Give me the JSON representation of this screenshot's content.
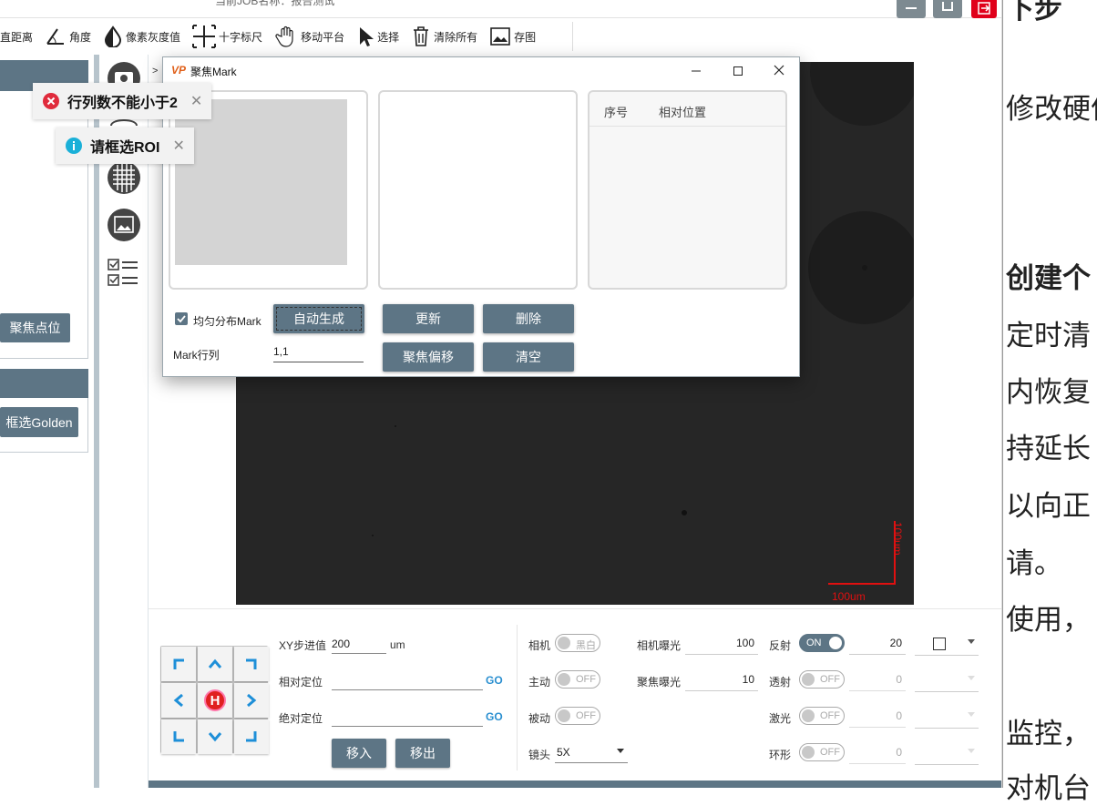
{
  "window": {
    "title_partial": "当前JOB名称：报告测试"
  },
  "toolbar": {
    "items": [
      {
        "label": "直距离",
        "icon": "ruler-icon"
      },
      {
        "label": "角度",
        "icon": "angle-icon"
      },
      {
        "label": "像素灰度值",
        "icon": "grayscale-icon"
      },
      {
        "label": "十字标尺",
        "icon": "crosshair-icon"
      },
      {
        "label": "移动平台",
        "icon": "hand-move-icon"
      },
      {
        "label": "选择",
        "icon": "cursor-icon"
      },
      {
        "label": "清除所有",
        "icon": "trash-icon"
      },
      {
        "label": "存图",
        "icon": "save-image-icon"
      }
    ]
  },
  "left_panel": {
    "focus_points_button": "聚焦点位",
    "select_golden_button": "框选Golden"
  },
  "toasts": [
    {
      "type": "error",
      "text": "行列数不能小于2"
    },
    {
      "type": "info",
      "text": "请框选ROI"
    }
  ],
  "viewer": {
    "scale_x_label": "100um",
    "scale_y_label": "100um",
    "colors": {
      "scale": "#e01010",
      "image_bg": "#262626"
    }
  },
  "dialog": {
    "logo": "VP",
    "title": "聚焦Mark",
    "table_headers": [
      "序号",
      "相对位置"
    ],
    "uniform_checkbox_label": "均匀分布Mark",
    "uniform_checked": true,
    "auto_generate_button": "自动生成",
    "update_button": "更新",
    "delete_button": "删除",
    "focus_offset_button": "聚焦偏移",
    "clear_button": "清空",
    "rows_cols_label": "Mark行列",
    "rows_cols_value": "1,1"
  },
  "bottom": {
    "xy_step_label": "XY步进值",
    "xy_step_value": "200",
    "xy_step_unit": "um",
    "relative_pos_label": "相对定位",
    "absolute_pos_label": "绝对定位",
    "go_label": "GO",
    "move_in_button": "移入",
    "move_out_button": "移出",
    "home_label": "H",
    "camera_label": "相机",
    "camera_toggle": "黑白",
    "active_label": "主动",
    "active_toggle": "OFF",
    "passive_label": "被动",
    "passive_toggle": "OFF",
    "lens_label": "镜头",
    "lens_value": "5X",
    "camera_exposure_label": "相机曝光",
    "camera_exposure_value": "100",
    "focus_exposure_label": "聚焦曝光",
    "focus_exposure_value": "10",
    "reflect_label": "反射",
    "reflect_toggle": "ON",
    "reflect_value": "20",
    "transmit_label": "透射",
    "transmit_toggle": "OFF",
    "transmit_value": "0",
    "laser_label": "激光",
    "laser_toggle": "OFF",
    "laser_value": "0",
    "ring_label": "环形",
    "ring_toggle": "OFF",
    "ring_value": "0"
  },
  "document": {
    "lines": [
      "下步",
      "修改硬件",
      "创建个",
      "定时清",
      "内恢复",
      "持延长",
      "以向正",
      "请。",
      "使用，",
      "监控，",
      "对机台"
    ]
  }
}
